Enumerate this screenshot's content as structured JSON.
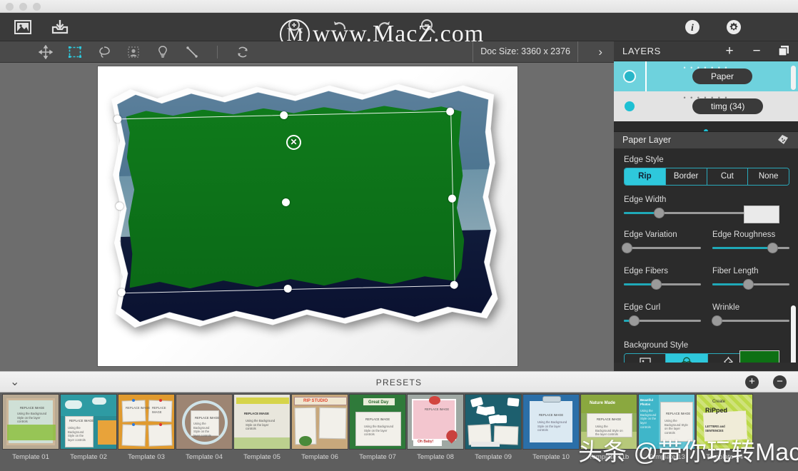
{
  "window": {
    "traffic_lights": [
      "close",
      "minimize",
      "zoom"
    ]
  },
  "watermarks": {
    "top": "www.MacZ.com",
    "top_logo": "M",
    "bottom": "头条 @带你玩转Mac"
  },
  "toolbar": {
    "left_icons": [
      {
        "name": "image-placeholder-icon",
        "label": "Image"
      },
      {
        "name": "import-tray-icon",
        "label": "Import"
      }
    ],
    "center_icons": [
      {
        "name": "zoom-in-icon",
        "label": "Zoom In"
      },
      {
        "name": "zoom-out-icon",
        "label": "Zoom Out"
      },
      {
        "name": "undo-icon",
        "label": "Undo"
      },
      {
        "name": "redo-icon",
        "label": "Redo"
      },
      {
        "name": "magnifier-minus-icon",
        "label": "Zoom Reset"
      }
    ],
    "right_icons": [
      {
        "name": "info-icon",
        "label": "Info"
      },
      {
        "name": "gear-icon",
        "label": "Settings"
      }
    ]
  },
  "subtoolbar": {
    "tools": [
      {
        "name": "move-tool",
        "label": "Move",
        "selected": false
      },
      {
        "name": "crop-tool",
        "label": "Crop",
        "selected": true
      },
      {
        "name": "lasso-tool",
        "label": "Lasso",
        "selected": false
      },
      {
        "name": "portrait-tool",
        "label": "Portrait",
        "selected": false
      },
      {
        "name": "lightbulb-tool",
        "label": "Light",
        "selected": false
      },
      {
        "name": "line-tool",
        "label": "Line",
        "selected": false
      },
      {
        "name": "rotate-tool",
        "label": "Rotate",
        "selected": false
      }
    ],
    "doc_size": "Doc Size: 3360 x 2376",
    "expand_chevron": "›"
  },
  "canvas": {
    "close_badge": "✕",
    "handles": 8,
    "selected_layer_color": "#0e7014"
  },
  "layers_panel": {
    "title": "LAYERS",
    "buttons": [
      {
        "name": "add-layer-button",
        "glyph": "+"
      },
      {
        "name": "remove-layer-button",
        "glyph": "−"
      },
      {
        "name": "duplicate-layer-button",
        "glyph": "❐"
      }
    ],
    "layers": [
      {
        "name": "Paper",
        "active": true
      },
      {
        "name": "timg (34)",
        "active": false
      }
    ]
  },
  "properties": {
    "section_title": "Paper Layer",
    "edge_style": {
      "label": "Edge Style",
      "options": [
        "Rip",
        "Border",
        "Cut",
        "None"
      ],
      "selected": "Rip"
    },
    "edge_width": {
      "label": "Edge Width",
      "value": 28
    },
    "sliders": [
      {
        "label": "Edge Variation",
        "value": 3
      },
      {
        "label": "Edge Roughness",
        "value": 78
      },
      {
        "label": "Edge Fibers",
        "value": 42
      },
      {
        "label": "Fiber Length",
        "value": 46
      },
      {
        "label": "Edge Curl",
        "value": 12
      },
      {
        "label": "Wrinkle",
        "value": 8
      }
    ],
    "background_style": {
      "label": "Background Style",
      "options": [
        {
          "name": "bg-image-icon",
          "selected": false
        },
        {
          "name": "bg-color-wheel-icon",
          "selected": true
        },
        {
          "name": "bg-paint-bucket-icon",
          "selected": false
        }
      ],
      "color": "#0e7014"
    }
  },
  "presets": {
    "title": "PRESETS",
    "collapse_chevron": "⌄",
    "add_label": "+",
    "remove_label": "−",
    "items": [
      {
        "label": "Template 01",
        "bg": "#b9aa93",
        "accent": "#8dbf3f",
        "style": "frame"
      },
      {
        "label": "Template 02",
        "bg": "#2e9ba3",
        "accent": "#ffffff",
        "style": "clouds"
      },
      {
        "label": "Template 03",
        "bg": "#e09a2e",
        "accent": "#ffffff",
        "style": "notes4"
      },
      {
        "label": "Template 04",
        "bg": "#9d8573",
        "accent": "#cfe3e8",
        "style": "oval"
      },
      {
        "label": "Template 05",
        "bg": "#e8e6dc",
        "accent": "#d6d44a",
        "style": "banner"
      },
      {
        "label": "Template 06",
        "bg": "#c8a87c",
        "accent": "#e0452e",
        "style": "ripstudio"
      },
      {
        "label": "Template 07",
        "bg": "#2f7a3a",
        "accent": "#ffffff",
        "style": "greatday"
      },
      {
        "label": "Template 08",
        "bg": "#9fa8a3",
        "accent": "#f3c6cf",
        "style": "baby"
      },
      {
        "label": "Template 09",
        "bg": "#1d5f6e",
        "accent": "#ffffff",
        "style": "papers"
      },
      {
        "label": "Template 10",
        "bg": "#2b6fa8",
        "accent": "#dbe9f2",
        "style": "clipboard"
      },
      {
        "label": "Template 11b",
        "bg": "#8fae5a",
        "accent": "#ffffff",
        "style": "nature"
      },
      {
        "label": "Template 13",
        "bg": "#63c6d6",
        "accent": "#ffffff",
        "style": "beautiful"
      },
      {
        "label": "Template 14",
        "bg": "#bcd94a",
        "accent": "#222222",
        "style": "ripped"
      }
    ],
    "replace_text": "REPLACE IMAGE",
    "hint_text": "Using the Background Style on the layer controls"
  },
  "colors": {
    "accent_cyan": "#2ec8dc",
    "panel_bg": "#2b2b2b",
    "toolbar_bg": "#3a3a3a",
    "canvas_bg": "#6d6d6d",
    "green_layer": "#0e7014"
  }
}
